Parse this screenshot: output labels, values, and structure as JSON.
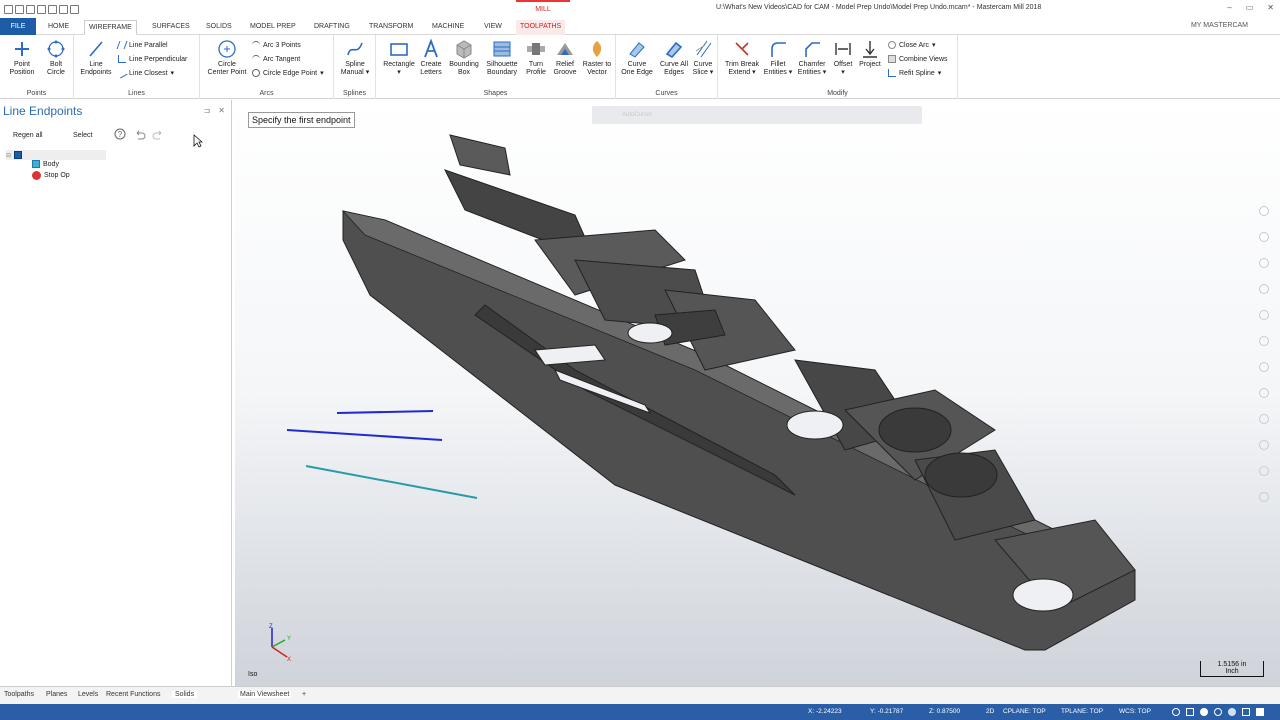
{
  "titlebar": {
    "mill_tab": "MILL",
    "window_title": "U:\\What's New Videos\\CAD for CAM - Model Prep Undo\\Model Prep Undo.mcam* - Mastercam Mill 2018",
    "controls": [
      "–",
      "▭",
      "✕"
    ]
  },
  "tabs": {
    "file": "FILE",
    "home": "HOME",
    "wireframe": "WIREFRAME",
    "surfaces": "SURFACES",
    "solids": "SOLIDS",
    "model_prep": "MODEL PREP",
    "drafting": "DRAFTING",
    "transform": "TRANSFORM",
    "machine": "MACHINE",
    "view": "VIEW",
    "toolpaths": "TOOLPATHS",
    "my_mastercam": "MY MASTERCAM"
  },
  "ribbon": {
    "points": {
      "name": "Points",
      "point_position": [
        "Point",
        "Position"
      ],
      "bolt_circle": [
        "Bolt",
        "Circle"
      ]
    },
    "lines": {
      "name": "Lines",
      "line_endpoints": [
        "Line",
        "Endpoints"
      ],
      "line_parallel": "Line Parallel",
      "line_perpendicular": "Line Perpendicular",
      "line_closest": "Line Closest"
    },
    "arcs": {
      "name": "Arcs",
      "circle_center_point": [
        "Circle",
        "Center Point"
      ],
      "arc_3_points": "Arc 3 Points",
      "arc_tangent": "Arc Tangent",
      "circle_edge_point": "Circle Edge Point"
    },
    "splines": {
      "name": "Splines",
      "spline_manual": [
        "Spline",
        "Manual"
      ]
    },
    "shapes": {
      "name": "Shapes",
      "rectangle": [
        "Rectangle",
        ""
      ],
      "create_letters": [
        "Create",
        "Letters"
      ],
      "bounding_box": [
        "Bounding",
        "Box"
      ],
      "silhouette_boundary": [
        "Silhouette",
        "Boundary"
      ],
      "turn_profile": [
        "Turn",
        "Profile"
      ],
      "relief_groove": [
        "Relief",
        "Groove"
      ],
      "raster_to_vector": [
        "Raster to",
        "Vector"
      ]
    },
    "curves": {
      "name": "Curves",
      "curve_one_edge": [
        "Curve",
        "One Edge"
      ],
      "curve_all_edges": [
        "Curve All",
        "Edges"
      ],
      "curve_slice": [
        "Curve",
        "Slice"
      ]
    },
    "modify": {
      "name": "Modify",
      "trim_break_extend": [
        "Trim Break",
        "Extend"
      ],
      "fillet_entities": [
        "Fillet",
        "Entities"
      ],
      "chamfer_entities": [
        "Chamfer",
        "Entities"
      ],
      "offset": [
        "Offset",
        ""
      ],
      "project": [
        "Project",
        ""
      ],
      "close_arc": "Close Arc",
      "combine_views": "Combine Views",
      "refit_spline": "Refit Spline"
    }
  },
  "panel": {
    "title": "Line Endpoints",
    "regen_all": "Regen all",
    "select": "Select",
    "tree": {
      "body": "Body",
      "stop_op": "Stop Op"
    }
  },
  "bottom_tabs": [
    "Toolpaths",
    "Planes",
    "Levels",
    "Recent Functions",
    "Solids"
  ],
  "viewport": {
    "prompt": "Specify the first endpoint",
    "autocursor": "AutoCursor",
    "view_name": "Iso",
    "scale_value": "1.5156 in",
    "scale_unit": "Inch"
  },
  "viewsheet": {
    "name": "Main Viewsheet",
    "add": "+"
  },
  "status": {
    "x": "X:  -2.24223",
    "y": "Y:  -0.21787",
    "z": "Z:  0.87500",
    "mode": "2D",
    "cplane": "CPLANE: TOP",
    "tplane": "TPLANE: TOP",
    "wcs": "WCS: TOP"
  },
  "colors": {
    "accent": "#2a5fa8",
    "panel_title": "#2c6bb3",
    "toolpaths_tab": "#cc2222",
    "sketch_line_blue": "#1f2bd0",
    "sketch_line_teal": "#2a9aa8",
    "model": "#4a4a4a"
  }
}
